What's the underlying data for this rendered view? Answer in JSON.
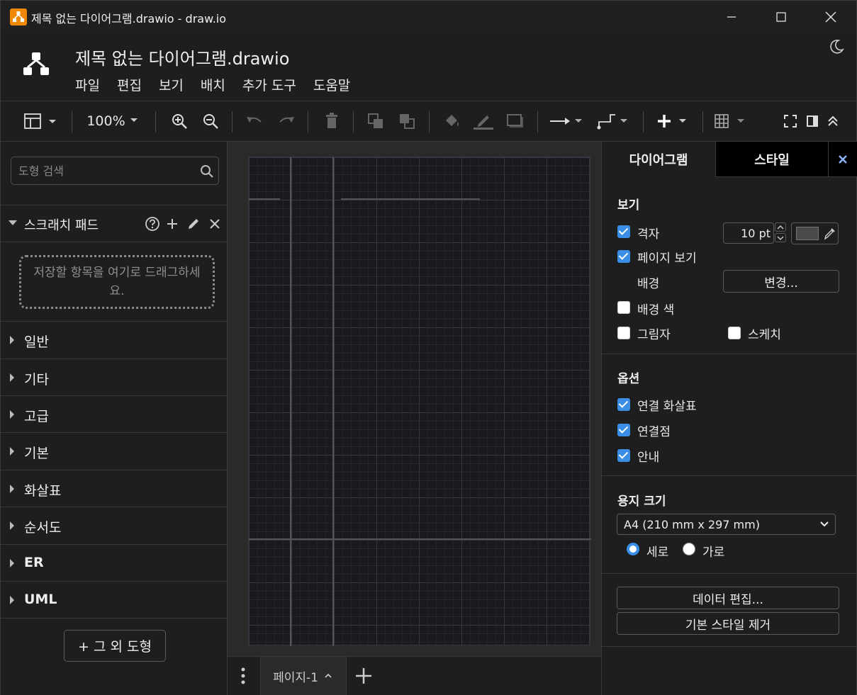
{
  "window": {
    "title": "제목 없는 다이어그램.drawio - draw.io"
  },
  "header": {
    "doc_title": "제목 없는 다이어그램.drawio",
    "menu": [
      "파일",
      "편집",
      "보기",
      "배치",
      "추가 도구",
      "도움말"
    ]
  },
  "toolbar": {
    "zoom": "100%"
  },
  "sidebar": {
    "search_placeholder": "도형 검색",
    "scratchpad_title": "스크래치 패드",
    "scratchpad_drop": "저장할 항목을 여기로 드래그하세요.",
    "categories": [
      "일반",
      "기타",
      "고급",
      "기본",
      "화살표",
      "순서도",
      "ER",
      "UML"
    ],
    "more_shapes": "+ 그 외 도형"
  },
  "pages": {
    "tab_label": "페이지-1"
  },
  "panel": {
    "tab_diagram": "다이어그램",
    "tab_style": "스타일",
    "view_title": "보기",
    "grid_label": "격자",
    "grid_size": "10 pt",
    "page_view_label": "페이지 보기",
    "background_label": "배경",
    "change_button": "변경...",
    "bg_color_label": "배경 색",
    "shadow_label": "그림자",
    "sketch_label": "스케치",
    "options_title": "옵션",
    "connection_arrows_label": "연결 화살표",
    "connection_points_label": "연결점",
    "guides_label": "안내",
    "paper_title": "용지 크기",
    "paper_size": "A4 (210 mm x 297 mm)",
    "portrait_label": "세로",
    "landscape_label": "가로",
    "edit_data_button": "데이터 편집...",
    "clear_style_button": "기본 스타일 제거"
  },
  "checks": {
    "grid": true,
    "page_view": true,
    "bg_color": false,
    "shadow": false,
    "sketch": false,
    "connection_arrows": true,
    "connection_points": true,
    "guides": true
  },
  "colors": {
    "accent": "#3a8ee6",
    "brand": "#f08705",
    "background": "#1e1e1e"
  }
}
